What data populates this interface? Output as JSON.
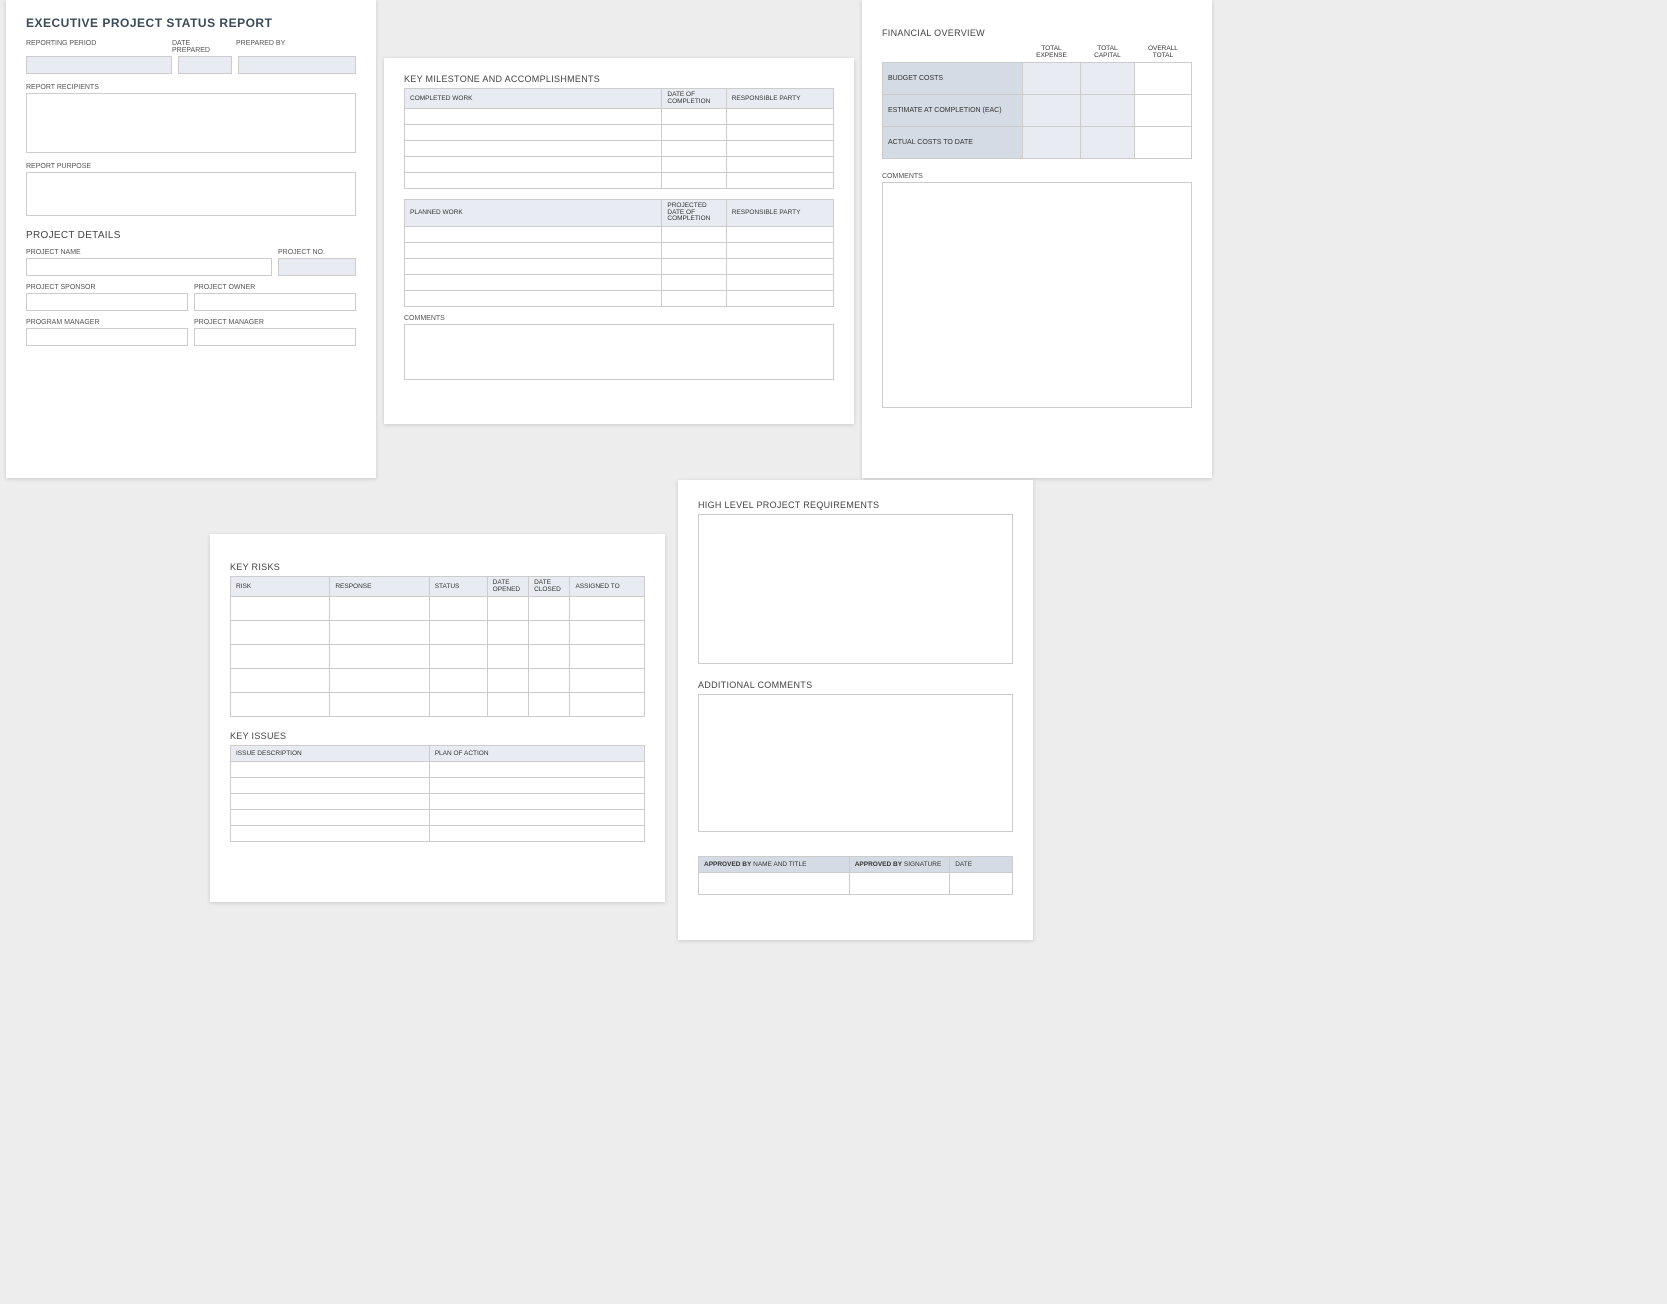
{
  "card1": {
    "title": "EXECUTIVE PROJECT STATUS REPORT",
    "reporting_period": "REPORTING PERIOD",
    "date_prepared": "DATE PREPARED",
    "prepared_by": "PREPARED BY",
    "report_recipients": "REPORT RECIPIENTS",
    "report_purpose": "REPORT PURPOSE",
    "project_details": "PROJECT DETAILS",
    "project_name": "PROJECT NAME",
    "project_no": "PROJECT NO.",
    "project_sponsor": "PROJECT SPONSOR",
    "project_owner": "PROJECT OWNER",
    "program_manager": "PROGRAM MANAGER",
    "project_manager": "PROJECT MANAGER"
  },
  "card2": {
    "title": "KEY MILESTONE AND ACCOMPLISHMENTS",
    "completed_work": "COMPLETED WORK",
    "date_of_completion": "DATE OF COMPLETION",
    "responsible_party": "RESPONSIBLE PARTY",
    "planned_work": "PLANNED WORK",
    "projected_date": "PROJECTED DATE OF COMPLETION",
    "comments": "COMMENTS"
  },
  "card3": {
    "title": "FINANCIAL OVERVIEW",
    "total_expense": "TOTAL EXPENSE",
    "total_capital": "TOTAL CAPITAL",
    "overall_total": "OVERALL TOTAL",
    "budget_costs": "BUDGET COSTS",
    "eac": "ESTIMATE AT COMPLETION (EAC)",
    "actual_costs": "ACTUAL COSTS TO DATE",
    "comments": "COMMENTS"
  },
  "card4": {
    "key_risks": "KEY RISKS",
    "risk": "RISK",
    "response": "RESPONSE",
    "status": "STATUS",
    "date_opened": "DATE OPENED",
    "date_closed": "DATE CLOSED",
    "assigned_to": "ASSIGNED TO",
    "key_issues": "KEY ISSUES",
    "issue_description": "ISSUE DESCRIPTION",
    "plan_of_action": "PLAN OF ACTION"
  },
  "card5": {
    "requirements": "HIGH LEVEL PROJECT REQUIREMENTS",
    "additional_comments": "ADDITIONAL COMMENTS",
    "approved_by_bold": "APPROVED BY",
    "name_title": " NAME AND TITLE",
    "signature": " SIGNATURE",
    "date": "DATE"
  }
}
